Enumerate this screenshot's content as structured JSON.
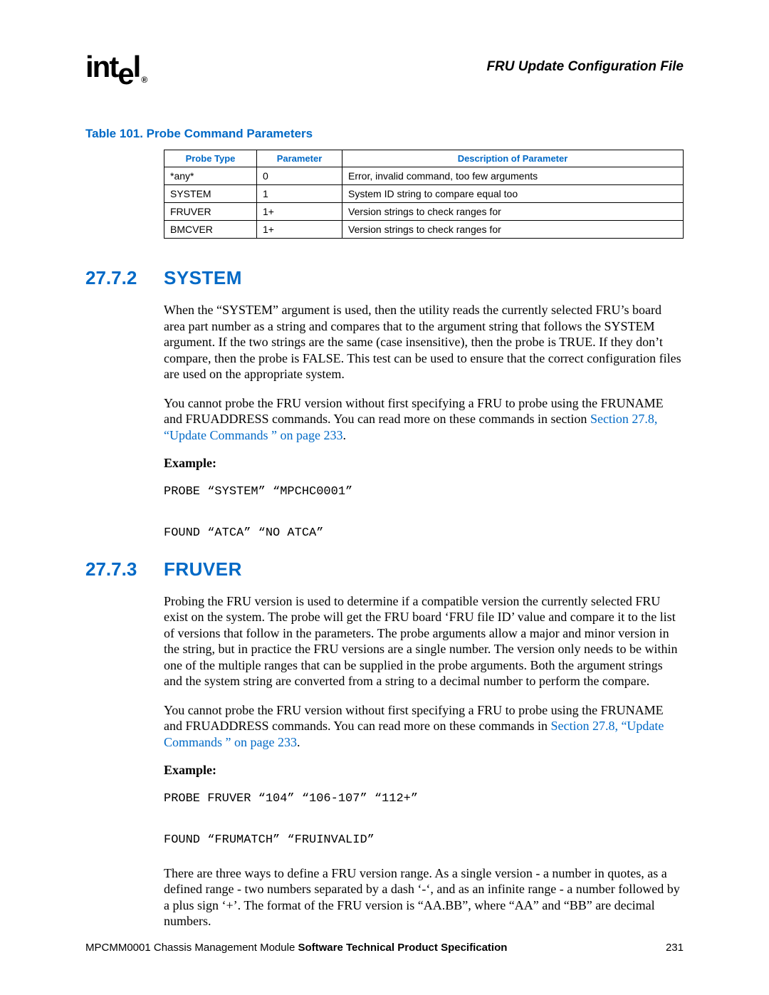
{
  "header": {
    "logo_text": "intel",
    "doc_title": "FRU Update Configuration File"
  },
  "table": {
    "caption": "Table 101. Probe Command Parameters",
    "headers": [
      "Probe Type",
      "Parameter",
      "Description of Parameter"
    ],
    "rows": [
      {
        "c0": "*any*",
        "c1": "0",
        "c2": "Error, invalid command, too few arguments"
      },
      {
        "c0": "SYSTEM",
        "c1": "1",
        "c2": "System ID string to compare equal too"
      },
      {
        "c0": "FRUVER",
        "c1": "1+",
        "c2": "Version strings to check ranges for"
      },
      {
        "c0": "BMCVER",
        "c1": "1+",
        "c2": "Version strings to check ranges for"
      }
    ]
  },
  "sections": {
    "s1": {
      "num": "27.7.2",
      "title": "SYSTEM",
      "p1": "When the “SYSTEM” argument is used, then the utility reads the currently selected FRU’s board area part number as a string and compares that to the argument string that follows the SYSTEM argument. If the two strings are the same (case insensitive), then the probe is TRUE. If they don’t compare, then the probe is FALSE. This test can be used to ensure that the correct configuration files are used on the appropriate system.",
      "p2a": "You cannot probe the FRU version without first specifying a FRU to probe using the FRUNAME and FRUADDRESS commands. You can read more on these commands in section ",
      "p2link": "Section 27.8, “Update Commands ” on page 233",
      "p2b": ".",
      "example_label": "Example:",
      "code": "PROBE “SYSTEM” “MPCHC0001”\n\nFOUND “ATCA” “NO ATCA”"
    },
    "s2": {
      "num": "27.7.3",
      "title": "FRUVER",
      "p1": "Probing the FRU version is used to determine if a compatible version the currently selected FRU exist on the system. The probe will get the FRU board ‘FRU file ID’ value and compare it to the list of versions that follow in the parameters. The probe arguments allow a major and minor version in the string, but in practice the FRU versions are a single number. The version only needs to be within one of the multiple ranges that can be supplied in the probe arguments. Both the argument strings and the system string are converted from a string to a decimal number to perform the compare.",
      "p2a": "You cannot probe the FRU version without first specifying a FRU to probe using the FRUNAME and FRUADDRESS commands. You can read more on these commands in ",
      "p2link": "Section 27.8, “Update Commands ” on page 233",
      "p2b": ".",
      "example_label": "Example:",
      "code": "PROBE FRUVER “104” “106-107” “112+”\n\nFOUND “FRUMATCH” “FRUINVALID”",
      "p3": "There are three ways to define a FRU version range. As a single version - a number in quotes, as a defined range - two numbers separated by a dash ‘-‘, and as an infinite range - a number followed by a plus sign ‘+’. The format of the FRU version is “AA.BB”, where “AA” and “BB” are decimal numbers."
    }
  },
  "footer": {
    "left_prefix": "MPCMM0001 Chassis Management Module ",
    "left_bold": "Software Technical Product Specification",
    "page_num": "231"
  }
}
